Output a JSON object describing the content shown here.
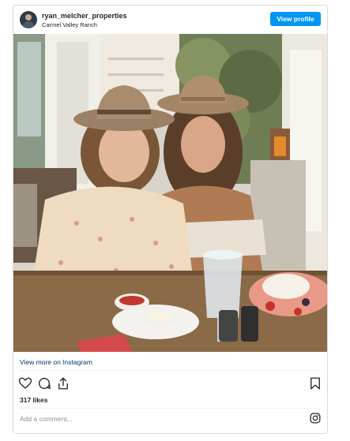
{
  "post": {
    "username": "ryan_melcher_properties",
    "location": "Carmel Valley Ranch",
    "view_profile_label": "View profile",
    "view_more_label": "View more on Instagram",
    "likes": "317 likes",
    "comment_placeholder": "Add a comment..."
  },
  "icons": {
    "like": "heart-icon",
    "comment": "comment-icon",
    "share": "share-icon",
    "save": "bookmark-icon",
    "brand": "instagram-icon"
  },
  "colors": {
    "accent": "#0095f6",
    "link": "#00376b",
    "muted": "#8e8e8e"
  }
}
